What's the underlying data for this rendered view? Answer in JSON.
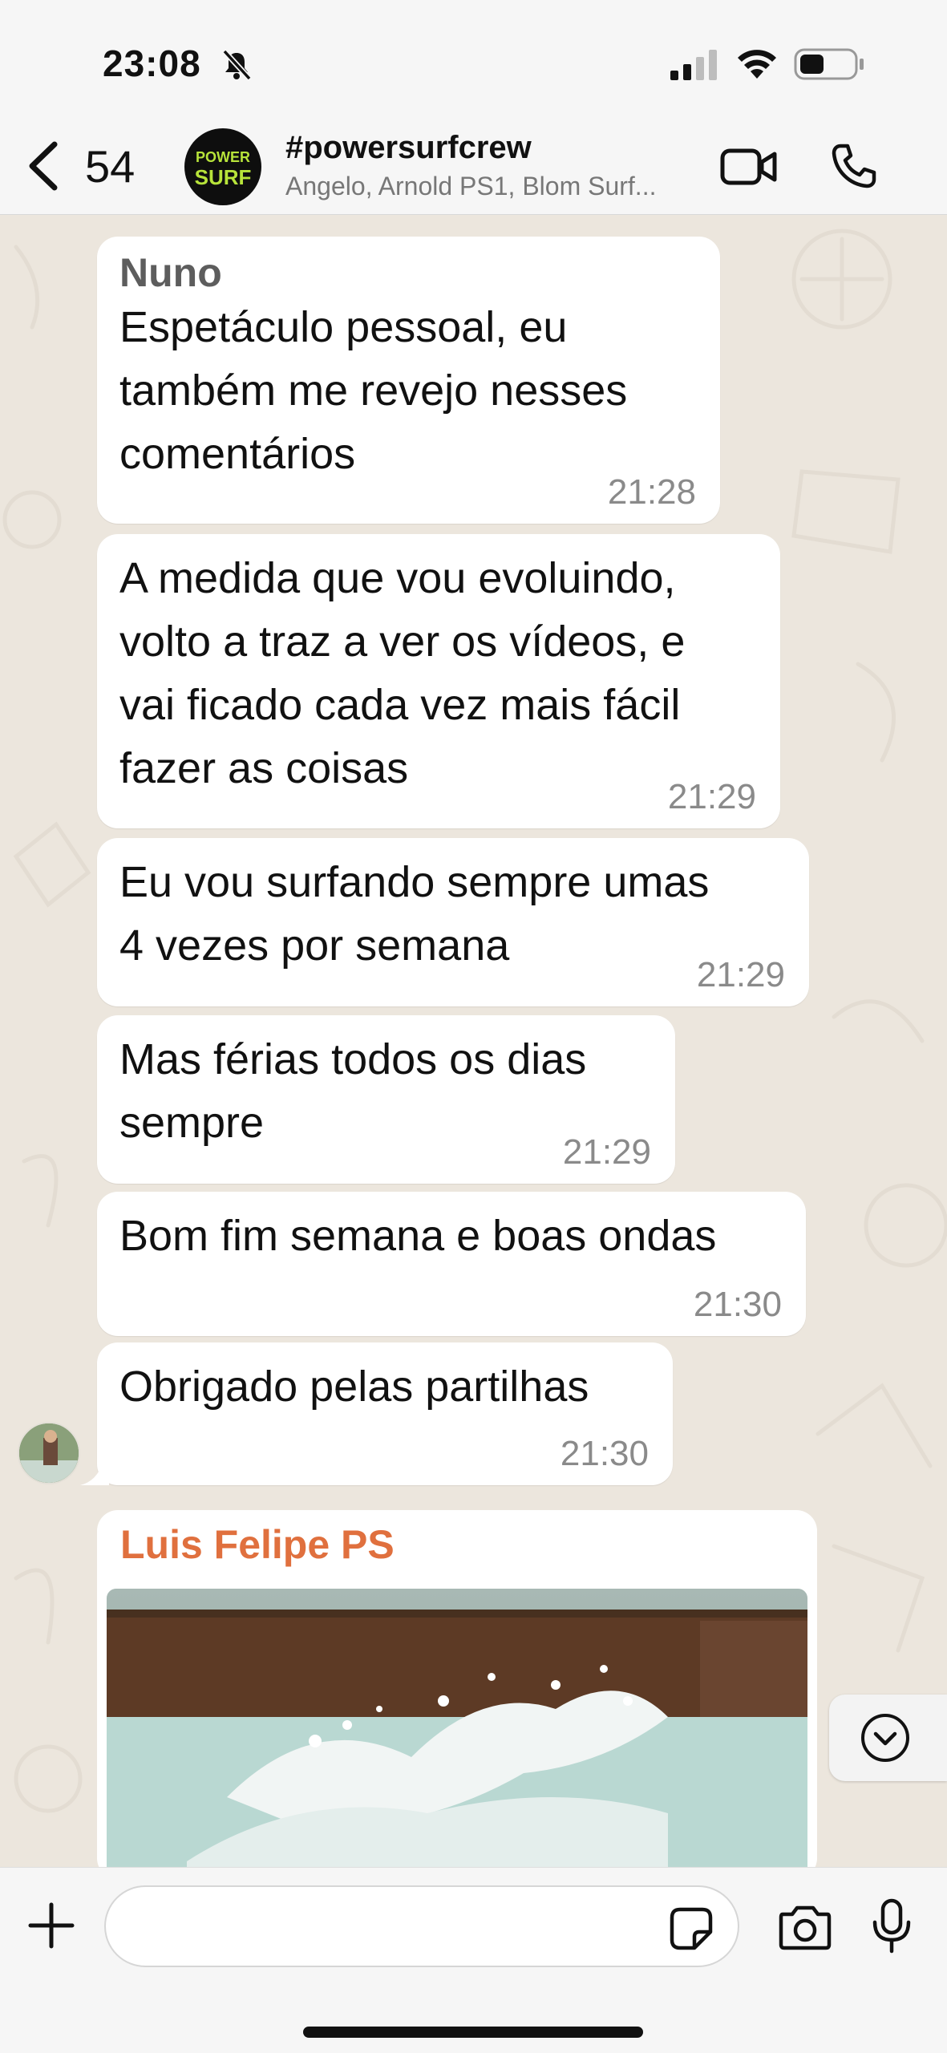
{
  "status_bar": {
    "time": "23:08",
    "battery_level": 0.45
  },
  "header": {
    "back_count": "54",
    "avatar_text_top": "POWER",
    "avatar_text_bottom": "SURF",
    "group_name": "#powersurfcrew",
    "members": "Angelo, Arnold PS1, Blom Surf..."
  },
  "messages": [
    {
      "sender": "Nuno",
      "text": "Espetáculo pessoal, eu\ntambém me revejo nesses\ncomentários",
      "time": "21:28"
    },
    {
      "text": "A medida que vou evoluindo,\nvolto a traz a ver os vídeos, e\nvai ficado cada vez mais fácil\nfazer as coisas",
      "time": "21:29"
    },
    {
      "text": "Eu vou surfando sempre umas\n4 vezes por semana",
      "time": "21:29"
    },
    {
      "text": "Mas férias todos os dias\nsempre",
      "time": "21:29"
    },
    {
      "text": "Bom fim semana e boas ondas",
      "time": "21:30"
    },
    {
      "text": "Obrigado pelas partilhas",
      "time": "21:30"
    }
  ],
  "image_message": {
    "sender": "Luis Felipe PS",
    "image": "surf-wave-photo"
  },
  "input": {
    "placeholder": "",
    "value": ""
  },
  "icons": [
    "mute-icon",
    "signal-icon",
    "wifi-icon",
    "battery-icon",
    "back-icon",
    "video-call-icon",
    "phone-icon",
    "chevron-down-icon",
    "plus-icon",
    "sticker-icon",
    "camera-icon",
    "microphone-icon"
  ],
  "colors": {
    "sender_name_nuno": "#5d5d5d",
    "sender_name_luis": "#e0703e",
    "chat_background": "#ece6dd",
    "bubble": "#ffffff"
  }
}
